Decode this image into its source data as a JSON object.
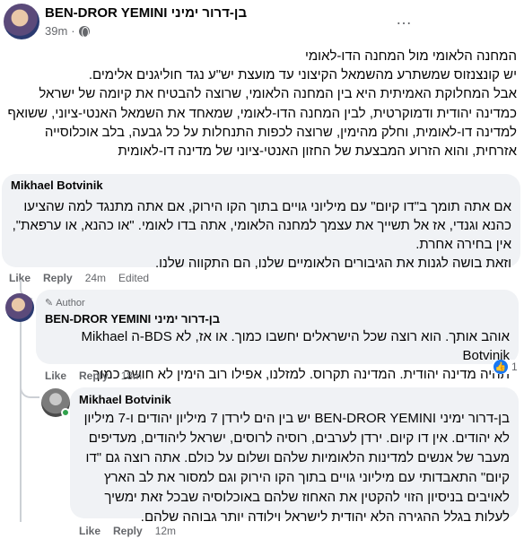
{
  "post": {
    "author": "BEN-DROR YEMINI בן-דרור ימיני",
    "time": "39m",
    "more_icon": "…",
    "paragraphs": [
      "המחנה הלאומי מול המחנה הדו-לאומי",
      "יש קונצנזוס שמשתרע מהשמאל הקיצוני עד מועצת יש\"ע נגד חוליגנים אלימים.",
      "אבל המחלוקת האמיתית היא בין המחנה הלאומי, שרוצה להבטיח את קיומה של ישראל כמדינה יהודית ודמוקרטית, לבין המחנה הדו-לאומי, שמאחד את השמאל האנטי-ציוני, ששואף למדינה דו-לאומית, וחלק מהימין, שרוצה לכפות התנחלות על כל גבעה, בלב אוכלוסייה אזרחית, והוא הזרוע המבצעת של החזון האנטי-ציוני של מדינה דו-לאומית"
    ]
  },
  "comments": [
    {
      "author": "Mikhael Botvinik",
      "paragraphs": [
        "אם אתה תומך ב\"דו קיום\" עם מיליוני גויים בתוך הקו הירוק, אם אתה מתנגד למה שהציעו כהנא וגנדי, אז אל תשייך את עצמך למחנה הלאומי, אתה בדו לאומי. \"או כהנא, או ערפאת\", אין בחירה אחרת.",
        "וזאת בושה לגנות את הגיבורים הלאומיים שלנו, הם התקווה שלנו."
      ],
      "actions": {
        "like": "Like",
        "reply": "Reply",
        "time": "24m",
        "edited": "Edited"
      }
    },
    {
      "badge": "Author",
      "author": "BEN-DROR YEMINI בן-דרור ימיני",
      "paragraphs": [
        "אוהב אותך. הוא רוצה שכל הישראלים יחשבו כמוך. או אז, לא BDS-ה Mikhael Botvinik",
        "תהיה מדינה יהודית. המדינה תקרוס. למזלנו, אפילו רוב הימין לא חושב כמוך"
      ],
      "actions": {
        "like": "Like",
        "reply": "Reply",
        "time": "18m"
      },
      "reaction_count": "1"
    },
    {
      "author": "Mikhael Botvinik",
      "paragraphs": [
        "בן-דרור ימיני BEN-DROR YEMINI יש בין הים לירדן 7 מיליון יהודים ו-7 מיליון לא יהודים. אין דו קיום. ירדן לערבים, רוסיה לרוסים, ישראל ליהודים, מעדיפים מעבר של אנשים למדינות הלאומיות שלהם ושלום על כולם. אתה רוצה גם \"דו קיום\" התאבדותי עם מיליוני גויים בתוך הקו הירוק וגם למסור את לב הארץ לאויבים בניסיון הזוי להקטין את האחוז שלהם באוכלוסיה שבכל זאת ימשיך לעלות בגלל ההגירה הלא יהודית לישראל וילודה יותר גבוהה שלהם."
      ],
      "actions": {
        "like": "Like",
        "reply": "Reply",
        "time": "12m"
      }
    }
  ]
}
